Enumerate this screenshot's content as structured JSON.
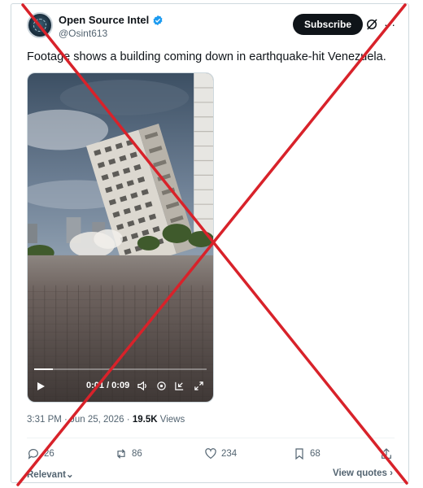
{
  "account": {
    "name": "Open Source Intel",
    "handle": "@Osint613",
    "avatar_icon": "osint-logo-icon",
    "verified_icon": "verified-badge-icon"
  },
  "header": {
    "subscribe_label": "Subscribe",
    "grok_icon": "grok-icon",
    "more_icon": "more-icon"
  },
  "tweet": {
    "text": "Footage shows a building coming down in earthquake-hit Venezuela."
  },
  "video": {
    "time": "0:01 / 0:09",
    "progress_fraction": 0.11,
    "icons": [
      "play-icon",
      "volume-icon",
      "settings-icon",
      "minimize-icon",
      "fullscreen-icon"
    ]
  },
  "meta": {
    "time": "3:31 PM",
    "separator": "·",
    "date": "Jun 25, 2026",
    "views_count": "19.5K",
    "views_label": "Views"
  },
  "actions": {
    "replies": "26",
    "reposts": "86",
    "likes": "234",
    "bookmarks": "68"
  },
  "footer": {
    "sort_label": "Relevant",
    "view_quotes_label": "View quotes"
  },
  "colors": {
    "cross": "#d8222a",
    "verified": "#1d9bf0",
    "text_secondary": "#536471"
  }
}
